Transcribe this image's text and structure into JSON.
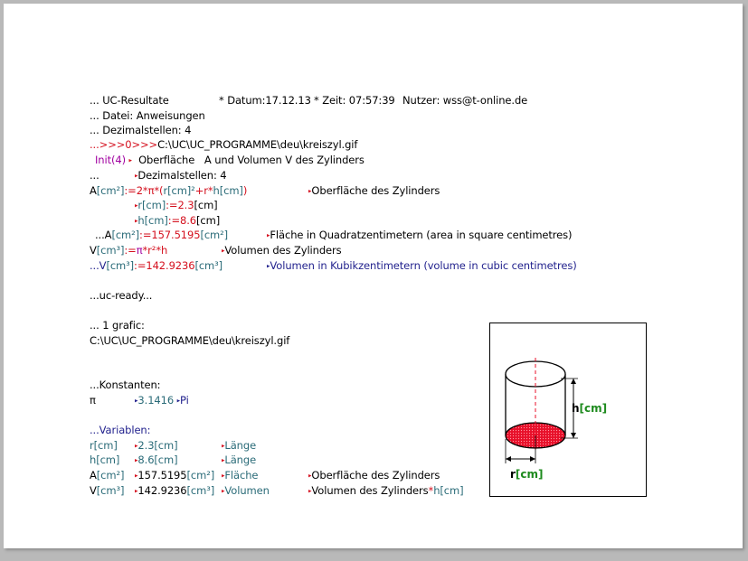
{
  "header": {
    "title": "... UC-Resultate",
    "date": "* Datum:17.12.13",
    "time": "* Zeit: 07:57:39",
    "user": "Nutzer: wss@t-online.de"
  },
  "file_line": "... Datei: Anweisungen",
  "decimals_line": "... Dezimalstellen: 4",
  "path_line": {
    "prefix": "...>>>0>>>",
    "path": "C:\\UC\\UC_PROGRAMME\\deu\\kreiszyl.gif"
  },
  "init_line": {
    "init": "Init(4)",
    "text": "Oberfläche   A und Volumen V des Zylinders"
  },
  "dec_sub": {
    "prefix": "...",
    "text": "Dezimalstellen: 4"
  },
  "formula_A": {
    "lhs": "A",
    "unit": "[cm²]",
    "eq": ":=2*",
    "pi": "π",
    "mul": "*(",
    "r": "r[cm]²",
    "plus": "+r*",
    "h": "h[cm]",
    "close": ")",
    "comment": "Oberfläche des Zylinders"
  },
  "input_r": {
    "name": "r[cm]",
    "eq": ":=2.3",
    "unit": "[cm]"
  },
  "input_h": {
    "name": "h[cm]",
    "eq": ":=8.6",
    "unit": "[cm]"
  },
  "result_A": {
    "prefix": "...A",
    "unit": "[cm²]",
    "eq": ":=157.5195",
    "unit2": "[cm²]",
    "comment": "Fläche in Quadratzentimetern (area in square centimetres)"
  },
  "formula_V": {
    "lhs": "V",
    "unit": "[cm³]",
    "eq": ":=",
    "pi": "π",
    "rest": "*r²*h",
    "comment": "Volumen des Zylinders"
  },
  "result_V": {
    "prefix": "...V",
    "unit": "[cm³]",
    "eq": ":=142.9236",
    "unit2": "[cm³]",
    "comment": "Volumen in Kubikzentimetern (volume in cubic centimetres)"
  },
  "ready": "...uc-ready...",
  "grafic_count": "... 1 grafic:",
  "grafic_path": "C:\\UC\\UC_PROGRAMME\\deu\\kreiszyl.gif",
  "constants_title": "...Konstanten:",
  "constants": {
    "sym": "π",
    "value": "3.1416",
    "name": "Pi"
  },
  "variables_title": "...Variablen:",
  "variables": [
    {
      "name": "r",
      "unit": "[cm]",
      "value": "2.3",
      "vunit": "[cm]",
      "label": "Länge",
      "comment": ""
    },
    {
      "name": "h",
      "unit": "[cm]",
      "value": "8.6",
      "vunit": "[cm]",
      "label": "Länge",
      "comment": ""
    },
    {
      "name": "A",
      "unit": "[cm²]",
      "value": "157.5195",
      "vunit": "[cm²]",
      "label": "Fläche",
      "comment": "Oberfläche des Zylinders"
    },
    {
      "name": "V",
      "unit": "[cm³]",
      "value": "142.9236",
      "vunit": "[cm³]",
      "label": "Volumen",
      "comment": "Volumen des Zylinders",
      "suffix_op": "*",
      "suffix": "h[cm]"
    }
  ],
  "figure": {
    "h_label": "h",
    "h_unit": "[cm]",
    "r_label": "r",
    "r_unit": "[cm]"
  },
  "colors": {
    "red": "#d4101e",
    "blue": "#1f1f8c",
    "teal": "#2a6b78",
    "magenta": "#a000a0",
    "green": "#1d8a1d"
  }
}
